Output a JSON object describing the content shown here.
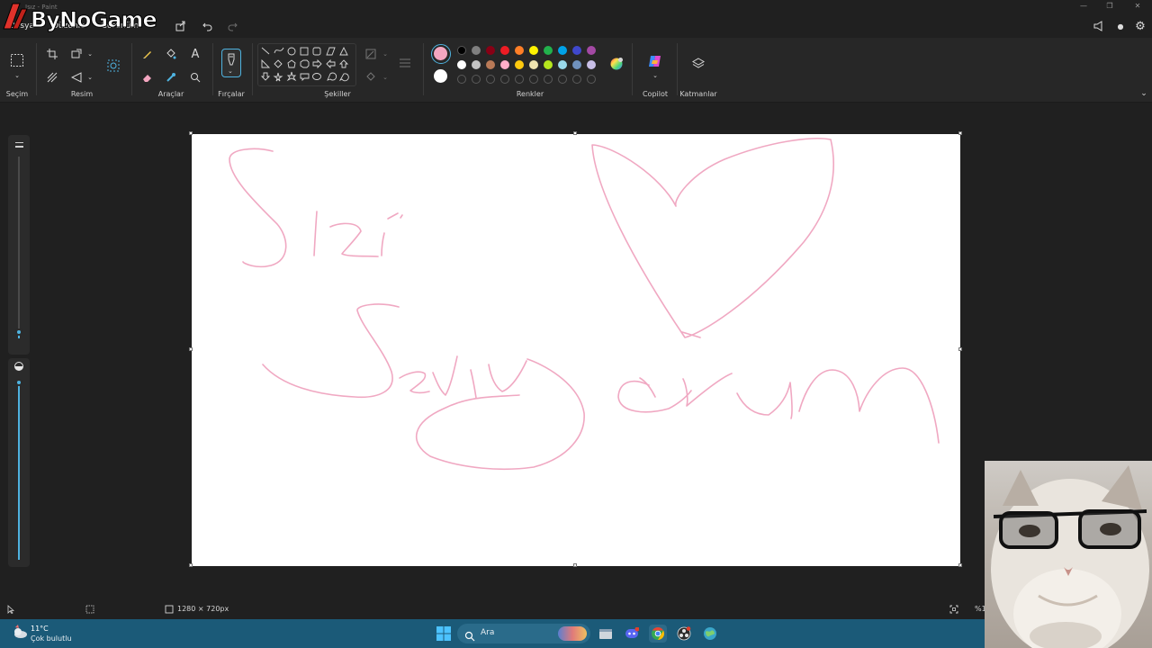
{
  "app": {
    "title": "Isız - Paint",
    "menu": [
      "Dosya",
      "Düzenle",
      "Görünüm"
    ]
  },
  "watermark": {
    "text": "ByNoGame"
  },
  "ribbon": {
    "groups": {
      "selection": "Seçim",
      "image": "Resim",
      "tools": "Araçlar",
      "brushes": "Fırçalar",
      "shapes": "Şekiller",
      "colors": "Renkler",
      "copilot": "Copilot",
      "layers": "Katmanlar"
    },
    "primary_color": "#f4a6c0",
    "secondary_color": "#ffffff",
    "palette_row1": [
      "#000000",
      "#7f7f7f",
      "#880015",
      "#ed1c24",
      "#ff7f27",
      "#fff200",
      "#22b14c",
      "#00a2e8",
      "#3f48cc",
      "#a349a4"
    ],
    "palette_row2": [
      "#ffffff",
      "#c3c3c3",
      "#b97a57",
      "#ffaec9",
      "#ffc90e",
      "#efe4b0",
      "#b5e61d",
      "#99d9ea",
      "#7092be",
      "#c8bfe7"
    ]
  },
  "canvas": {
    "drawing_color": "#f0a8c2"
  },
  "statusbar": {
    "canvas_size": "1280 × 720px",
    "zoom": "%1"
  },
  "taskbar": {
    "weather_temp": "11°C",
    "weather_desc": "Çok bulutlu",
    "search_placeholder": "Ara"
  }
}
